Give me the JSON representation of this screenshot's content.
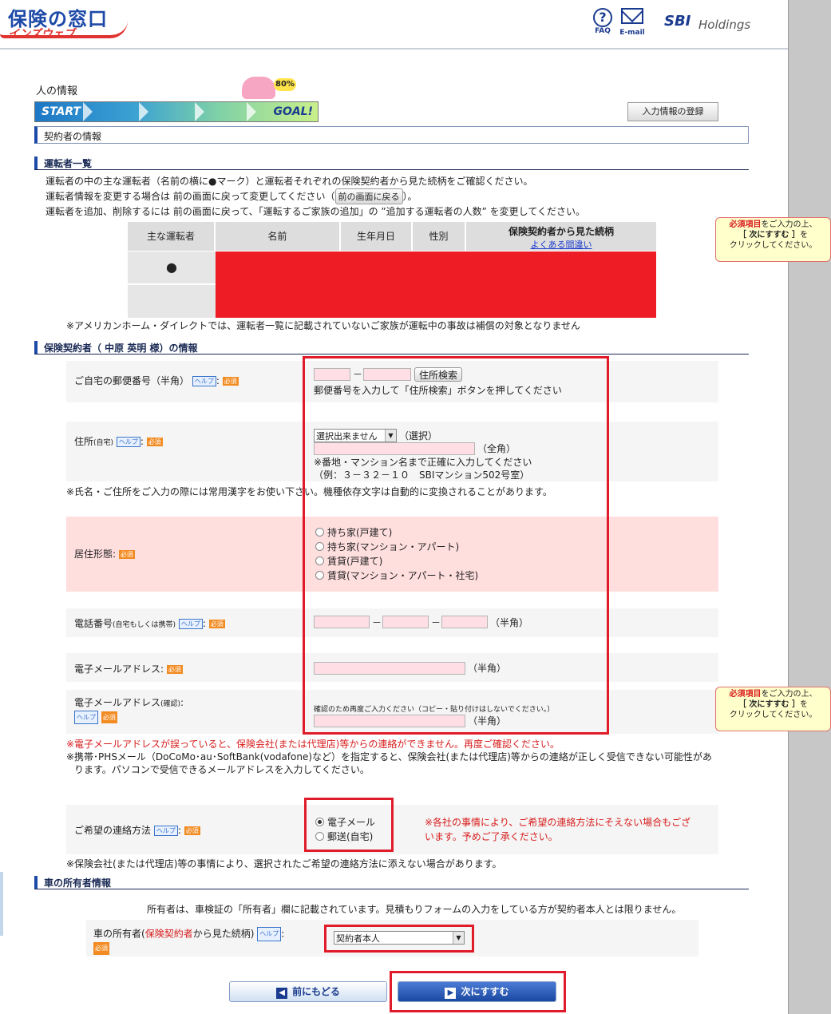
{
  "header": {
    "logo_top": "保険の窓口",
    "logo_bottom": "インズウェブ",
    "faq_label": "FAQ",
    "email_label": "E-mail",
    "sbi": "SBI",
    "holdings": "Holdings"
  },
  "progress": {
    "page_title": "人の情報",
    "start": "START",
    "goal": "GOAL!",
    "percent": "80%",
    "register_button": "入力情報の登録"
  },
  "section_contractor": "契約者の情報",
  "drivers": {
    "heading": "運転者一覧",
    "line1": "運転者の中の主な運転者（名前の横に●マーク）と運転者それぞれの保険契約者から見た続柄をご確認ください。",
    "line2a": "運転者情報を変更する場合は 前の画面に戻って変更してください（",
    "back_button": "前の画面に戻る",
    "line2b": "）。",
    "line3": "運転者を追加、削除するには 前の画面に戻って、「運転するご家族の追加」の ”追加する運転者の人数” を変更してください。",
    "columns": [
      "主な運転者",
      "名前",
      "生年月日",
      "性別",
      "保険契約者から見た続柄"
    ],
    "faq_link": "よくある間違い",
    "main_mark": "●",
    "note": "※アメリカンホーム・ダイレクトでは、運転者一覧に記載されていないご家族が運転中の事故は補償の対象となりません"
  },
  "side_note": {
    "bold": "必須項目",
    "text1": "をご入力の上、",
    "text2": "［ 次にすすむ ］",
    "text3": "を",
    "text4": "クリックしてください。"
  },
  "holder": {
    "heading": "保険契約者（ 中原 英明 様）の情報",
    "help": "ヘルプ",
    "required": "必須",
    "postal": {
      "label": "ご自宅の郵便番号（半角）",
      "dash": "－",
      "search_button": "住所検索",
      "hint": "郵便番号を入力して「住所検索」ボタンを押してください"
    },
    "address": {
      "label": "住所",
      "label_small": "(自宅)",
      "select_value": "選択出来ません",
      "select_suffix": "（選択）",
      "fullwidth": "（全角）",
      "hint1": "※番地・マンション名まで正確に入力してください",
      "hint2": "（例：３－３２－１０　SBIマンション502号室）",
      "note": "※氏名・ご住所をご入力の際には常用漢字をお使い下さい。機種依存文字は自動的に変換されることがあります。"
    },
    "residence": {
      "label": "居住形態:",
      "options": [
        "持ち家(戸建て)",
        "持ち家(マンション・アパート)",
        "賃貸(戸建て)",
        "賃貸(マンション・アパート・社宅)"
      ]
    },
    "phone": {
      "label": "電話番号",
      "label_small": "(自宅もしくは携帯)",
      "dash": "－",
      "halfwidth": "（半角）"
    },
    "email": {
      "label": "電子メールアドレス:",
      "halfwidth": "（半角）"
    },
    "email_confirm": {
      "label": "電子メールアドレス",
      "label_small": "(確認)",
      "colon": ":",
      "hint": "確認のため再度ご入力ください（コピー・貼り付けはしないでください。）",
      "halfwidth": "（半角）"
    },
    "email_warning": "※電子メールアドレスが誤っていると、保険会社(または代理店)等からの連絡ができません。再度ご確認ください。",
    "email_note1": "※携帯･PHSメール（DoCoMo･au･SoftBank(vodafone)など）を指定すると、保険会社(または代理店)等からの連絡が正しく受信できない可能性があ",
    "email_note2": "ります。パソコンで受信できるメールアドレスを入力してください。",
    "contact": {
      "label": "ご希望の連絡方法",
      "options": [
        "電子メール",
        "郵送(自宅)"
      ],
      "selected": "電子メール",
      "warning1": "※各社の事情により、ご希望の連絡方法にそえない場合もござ",
      "warning2": "います。予めご了承ください。",
      "note": "※保険会社(または代理店)等の事情により、選択されたご希望の連絡方法に添えない場合があります。"
    }
  },
  "owner": {
    "heading": "車の所有者情報",
    "note": "所有者は、車検証の「所有者」欄に記載されています。見積もりフォームの入力をしている方が契約者本人とは限りません。",
    "label_a": "車の所有者(",
    "label_b": "保険契約者",
    "label_c": "から見た続柄)",
    "colon": ":",
    "select_value": "契約者本人"
  },
  "nav": {
    "back": "前にもどる",
    "next": "次にすすむ"
  }
}
